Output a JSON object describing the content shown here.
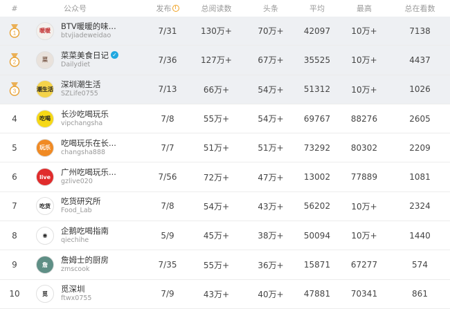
{
  "header": {
    "rank": "#",
    "account": "公众号",
    "publish": "发布",
    "total_reads": "总阅读数",
    "headline": "头条",
    "average": "平均",
    "max": "最高",
    "total_views": "总在看数"
  },
  "rows": [
    {
      "rank": "1",
      "name": "BTV暖暖的味...",
      "id": "btvjiadeweidao",
      "avatar_text": "暖暖",
      "avatar_bg": "#f4f0ec",
      "avatar_fg": "#c23030",
      "publish": "7/31",
      "total": "130万+",
      "headline": "70万+",
      "avg": "42097",
      "max": "10万+",
      "views": "7138"
    },
    {
      "rank": "2",
      "name": "菜菜美食日记",
      "id": "Dailydiet",
      "avatar_text": "菜",
      "avatar_bg": "#e9e2dc",
      "avatar_fg": "#7a5a4a",
      "verified": "✓",
      "publish": "7/36",
      "total": "127万+",
      "headline": "67万+",
      "avg": "35525",
      "max": "10万+",
      "views": "4437"
    },
    {
      "rank": "3",
      "name": "深圳潮生活",
      "id": "SZLife0755",
      "avatar_text": "潮生活",
      "avatar_bg": "#f4d34a",
      "avatar_fg": "#222",
      "publish": "7/13",
      "total": "66万+",
      "headline": "54万+",
      "avg": "51312",
      "max": "10万+",
      "views": "1026"
    },
    {
      "rank": "4",
      "name": "长沙吃喝玩乐",
      "id": "vipchangsha",
      "avatar_text": "吃喝",
      "avatar_bg": "#f6d816",
      "avatar_fg": "#222",
      "publish": "7/8",
      "total": "55万+",
      "headline": "54万+",
      "avg": "69767",
      "max": "88276",
      "views": "2605"
    },
    {
      "rank": "5",
      "name": "吃喝玩乐在长...",
      "id": "changsha888",
      "avatar_text": "玩乐",
      "avatar_bg": "#f08a24",
      "avatar_fg": "#fff",
      "publish": "7/7",
      "total": "51万+",
      "headline": "51万+",
      "avg": "73292",
      "max": "80302",
      "views": "2209"
    },
    {
      "rank": "6",
      "name": "广州吃喝玩乐...",
      "id": "gzlive020",
      "avatar_text": "live",
      "avatar_bg": "#e02c2c",
      "avatar_fg": "#fff",
      "publish": "7/56",
      "total": "72万+",
      "headline": "47万+",
      "avg": "13002",
      "max": "77889",
      "views": "1081"
    },
    {
      "rank": "7",
      "name": "吃货研究所",
      "id": "Food_Lab",
      "avatar_text": "吃货",
      "avatar_bg": "#ffffff",
      "avatar_fg": "#222",
      "publish": "7/8",
      "total": "54万+",
      "headline": "43万+",
      "avg": "56202",
      "max": "10万+",
      "views": "2324"
    },
    {
      "rank": "8",
      "name": "企鹅吃喝指南",
      "id": "qiechihe",
      "avatar_text": "◉",
      "avatar_bg": "#ffffff",
      "avatar_fg": "#222",
      "publish": "5/9",
      "total": "45万+",
      "headline": "38万+",
      "avg": "50094",
      "max": "10万+",
      "views": "1440"
    },
    {
      "rank": "9",
      "name": "詹姆士的厨房",
      "id": "zmscook",
      "avatar_text": "詹",
      "avatar_bg": "#5f8f86",
      "avatar_fg": "#fff",
      "publish": "7/35",
      "total": "55万+",
      "headline": "36万+",
      "avg": "15871",
      "max": "67277",
      "views": "574"
    },
    {
      "rank": "10",
      "name": "觅深圳",
      "id": "ftwx0755",
      "avatar_text": "觅",
      "avatar_bg": "#ffffff",
      "avatar_fg": "#222",
      "publish": "7/9",
      "total": "43万+",
      "headline": "40万+",
      "avg": "47881",
      "max": "70341",
      "views": "861"
    }
  ],
  "colors": {
    "medal": "#e8a030",
    "top_row_bg": "#eef0f3"
  }
}
